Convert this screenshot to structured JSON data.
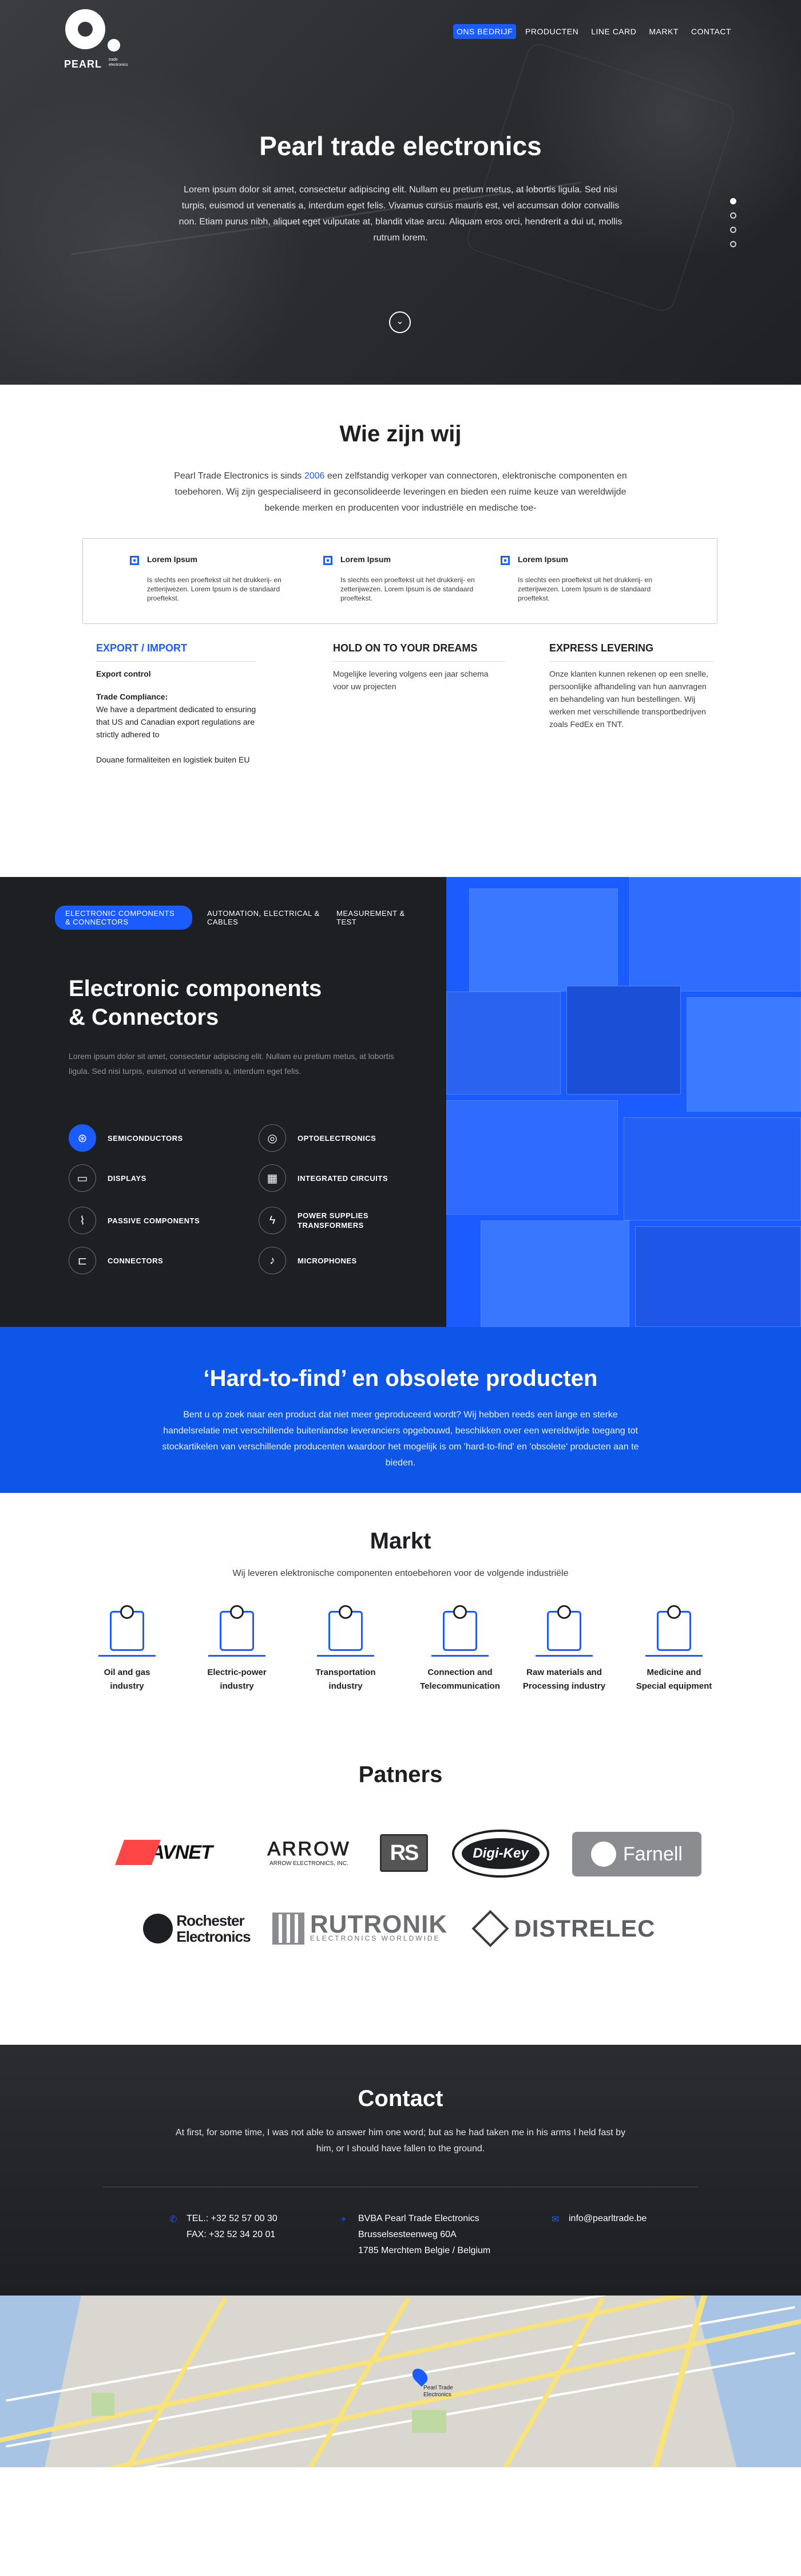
{
  "logo": {
    "name": "PEARL",
    "tag": "trade electronics"
  },
  "nav": {
    "items": [
      "ONS BEDRIJF",
      "PRODUCTEN",
      "LINE CARD",
      "MARKT",
      "CONTACT"
    ]
  },
  "hero": {
    "title": "Pearl trade electronics",
    "lead": "Lorem ipsum dolor sit amet, consectetur adipiscing elit. Nullam eu pretium metus, at lobortis ligula. Sed nisi turpis, euismod ut venenatis a, interdum eget felis. Vivamus cursus mauris est, vel accumsan dolor convallis non. Etiam purus nibh, aliquet eget vulputate at, blandit vitae arcu. Aliquam eros orci, hendrerit a dui ut, mollis rutrum lorem.",
    "slide_count": 4,
    "active_slide": 1
  },
  "about": {
    "title": "Wie zijn wij",
    "intro_a": "Pearl Trade Electronics is sinds ",
    "intro_year": "2006",
    "intro_b": " een zelfstandig verkoper van connectoren, elektronische componenten en toebehoren. Wij zijn gespecialiseerd in geconsolideerde leveringen en bieden een ruime keuze van wereldwijde bekende merken en producenten voor industriële en medische toe-",
    "features": [
      {
        "title": "Lorem Ipsum",
        "text": "Is slechts een proeftekst uit het drukkerij- en zetterijwezen. Lorem Ipsum is de standaard proeftekst."
      },
      {
        "title": "Lorem Ipsum",
        "text": "Is slechts een proeftekst uit het drukkerij- en zetterijwezen. Lorem Ipsum is de standaard proeftekst."
      },
      {
        "title": "Lorem Ipsum",
        "text": "Is slechts een proeftekst uit het drukkerij- en zetterijwezen. Lorem Ipsum is de standaard proeftekst."
      }
    ],
    "col1": {
      "title": "EXPORT / IMPORT",
      "p1": "Export control",
      "p2": "Trade Compliance:",
      "p3": "We have a department dedicated to ensuring that US and Canadian export regulations are strictly adhered to",
      "p4": "Douane formaliteiten en logistiek buiten EU"
    },
    "col2": {
      "title": "HOLD ON TO YOUR DREAMS",
      "p1": "Mogelijke levering volgens een jaar schema voor uw projecten"
    },
    "col3": {
      "title": "EXPRESS LEVERING",
      "p1": "Onze klanten kunnen rekenen op een snelle, persoonlijke afhandeling van hun aanvragen en behandeling van hun bestellingen. Wij werken met verschillende transportbedrijven zoals FedEx en TNT."
    }
  },
  "components": {
    "tabs": [
      "ELECTRONIC COMPONENTS & CONNECTORS",
      "AUTOMATION, ELECTRICAL & CABLES",
      "MEASUREMENT & TEST"
    ],
    "title_line1": "Electronic components",
    "title_line2": "& Connectors",
    "desc": "Lorem ipsum dolor sit amet, consectetur adipiscing elit. Nullam eu pretium metus, at lobortis ligula. Sed nisi turpis, euismod ut venenatis a, interdum eget felis.",
    "categories": [
      {
        "label": "SEMICONDUCTORS",
        "icon": "chip-icon",
        "glyph": "⊛"
      },
      {
        "label": "OPTOELECTRONICS",
        "icon": "optoelectronics-icon",
        "glyph": "◎"
      },
      {
        "label": "DISPLAYS",
        "icon": "display-icon",
        "glyph": "▭"
      },
      {
        "label": "INTEGRATED CIRCUITS",
        "icon": "integrated-circuit-icon",
        "glyph": "▦"
      },
      {
        "label": "PASSIVE COMPONENTS",
        "icon": "passive-component-icon",
        "glyph": "⌇"
      },
      {
        "label": "POWER SUPPLIES TRANSFORMERS",
        "icon": "power-supply-icon",
        "glyph": "ϟ"
      },
      {
        "label": "CONNECTORS",
        "icon": "connector-icon",
        "glyph": "⊏"
      },
      {
        "label": "MICROPHONES",
        "icon": "microphone-icon",
        "glyph": "♪"
      }
    ]
  },
  "hard": {
    "title": "‘Hard-to-find’ en obsolete producten",
    "text": "Bent u op zoek naar een product dat niet meer geproduceerd wordt? Wij hebben reeds een lange en sterke handelsrelatie met verschillende buitenlandse leveranciers opgebouwd, beschikken over een wereldwijde toegang tot stockartikelen van verschillende producenten waardoor het mogelijk is om 'hard-to-find' en 'obsolete' producten aan te bieden."
  },
  "markt": {
    "title": "Markt",
    "sub": "Wij leveren elektronische componenten entoebehoren voor de volgende industriële",
    "industries": [
      {
        "label1": "Oil and gas",
        "label2": "industry",
        "icon": "oil-pump-icon"
      },
      {
        "label1": "Electric-power",
        "label2": "industry",
        "icon": "power-tower-icon"
      },
      {
        "label1": "Transportation",
        "label2": "industry",
        "icon": "car-icon"
      },
      {
        "label1": "Connection and",
        "label2": "Telecommunication",
        "icon": "antenna-icon"
      },
      {
        "label1": "Raw materials and",
        "label2": "Processing industry",
        "icon": "factory-icon"
      },
      {
        "label1": "Medicine and",
        "label2": "Special equipment",
        "icon": "caduceus-icon"
      }
    ]
  },
  "partners": {
    "title": "Patners",
    "logos": [
      "AVNET",
      "ARROW",
      "ARROW ELECTRONICS, INC.",
      "RS",
      "Digi-Key",
      "Farnell",
      "Rochester",
      "Electronics",
      "RUTRONIK",
      "ELECTRONICS WORLDWIDE",
      "DISTRELEC"
    ]
  },
  "contact": {
    "title": "Contact",
    "lead": "At first, for some time, I was not able to answer him one word; but as he had taken me in his arms I held fast by him, or I should have fallen to the ground.",
    "tel": "TEL.: +32 52 57 00 30",
    "fax": "FAX: +32 52 34 20 01",
    "company": "BVBA Pearl Trade Electronics",
    "street": "Brusselsesteenweg 60A",
    "city": "1785 Merchtem Belgie / Belgium",
    "email": "info@pearltrade.be"
  },
  "map": {
    "pin_label": "Pearl Trade Electronics"
  },
  "colors": {
    "accent": "#1a5cff",
    "dark": "#1d1f22",
    "hard_bg": "#0d56e8"
  }
}
